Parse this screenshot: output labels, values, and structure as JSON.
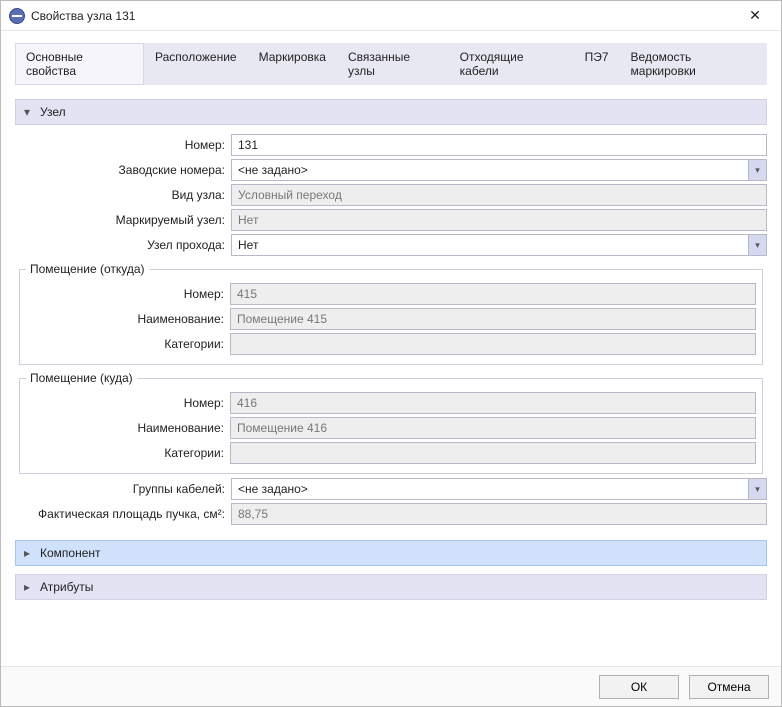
{
  "window": {
    "title": "Свойства узла 131"
  },
  "tabs": [
    {
      "label": "Основные свойства"
    },
    {
      "label": "Расположение"
    },
    {
      "label": "Маркировка"
    },
    {
      "label": "Связанные узлы"
    },
    {
      "label": "Отходящие кабели"
    },
    {
      "label": "ПЭ7"
    },
    {
      "label": "Ведомость маркировки"
    }
  ],
  "sections": {
    "node": {
      "title": "Узел"
    },
    "component": {
      "title": "Компонент"
    },
    "attributes": {
      "title": "Атрибуты"
    }
  },
  "labels": {
    "number": "Номер:",
    "factory_numbers": "Заводские номера:",
    "node_type": "Вид узла:",
    "marked_node": "Маркируемый узел:",
    "passage_node": "Узел прохода:",
    "room_from": "Помещение (откуда)",
    "room_to": "Помещение (куда)",
    "room_number": "Номер:",
    "room_name": "Наименование:",
    "room_categories": "Категории:",
    "cable_groups": "Группы кабелей:",
    "actual_bundle_area": "Фактическая площадь пучка, см²:"
  },
  "values": {
    "number": "131",
    "factory_numbers": "<не задано>",
    "node_type": "Условный переход",
    "marked_node": "Нет",
    "passage_node": "Нет",
    "room_from": {
      "number": "415",
      "name": "Помещение 415",
      "categories": ""
    },
    "room_to": {
      "number": "416",
      "name": "Помещение 416",
      "categories": ""
    },
    "cable_groups": "<не задано>",
    "actual_bundle_area": "88,75"
  },
  "buttons": {
    "ok": "ОК",
    "cancel": "Отмена"
  }
}
